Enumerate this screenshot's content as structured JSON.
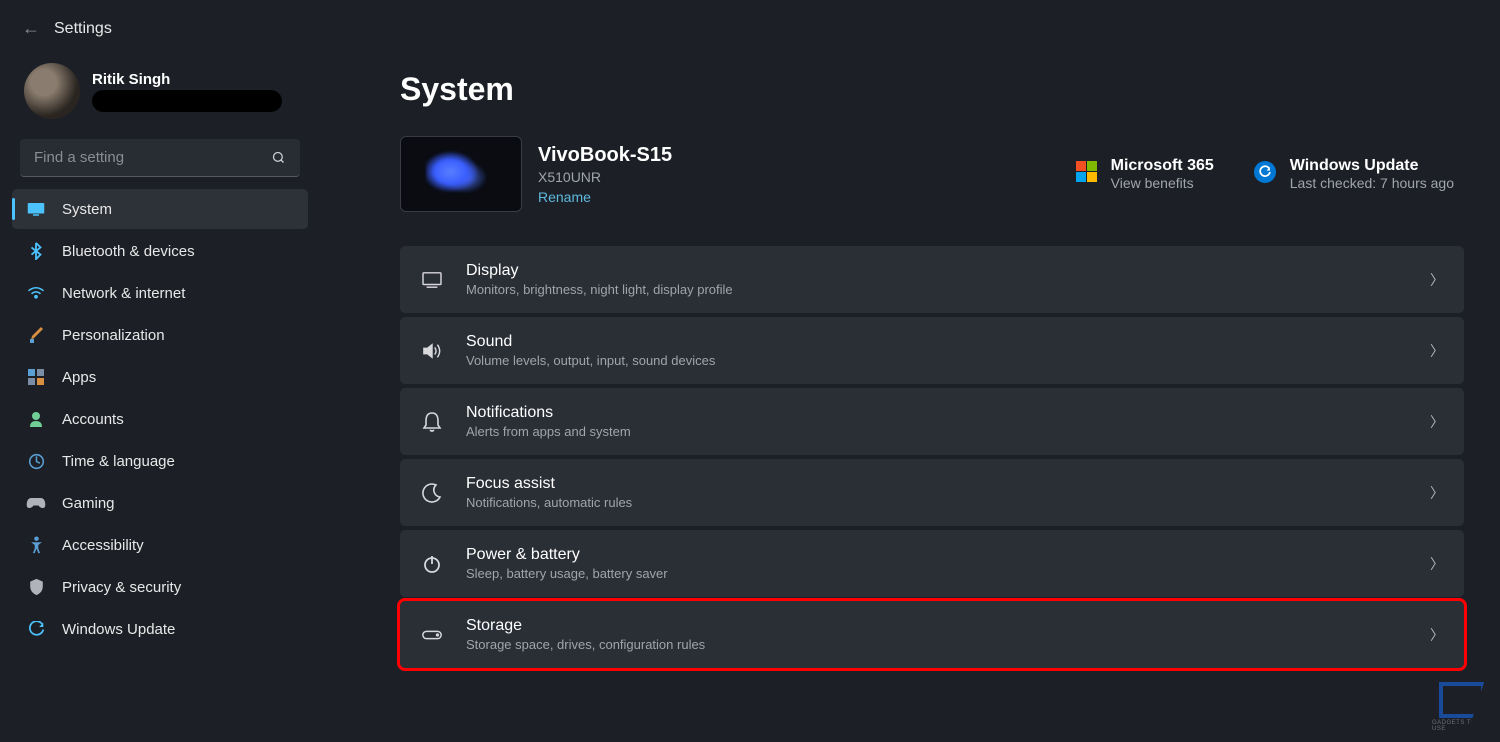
{
  "header": {
    "title": "Settings"
  },
  "user": {
    "name": "Ritik Singh"
  },
  "search": {
    "placeholder": "Find a setting"
  },
  "sidebar": {
    "items": [
      {
        "label": "System"
      },
      {
        "label": "Bluetooth & devices"
      },
      {
        "label": "Network & internet"
      },
      {
        "label": "Personalization"
      },
      {
        "label": "Apps"
      },
      {
        "label": "Accounts"
      },
      {
        "label": "Time & language"
      },
      {
        "label": "Gaming"
      },
      {
        "label": "Accessibility"
      },
      {
        "label": "Privacy & security"
      },
      {
        "label": "Windows Update"
      }
    ]
  },
  "page": {
    "title": "System"
  },
  "device": {
    "name": "VivoBook-S15",
    "model": "X510UNR",
    "rename": "Rename"
  },
  "cards": {
    "ms365_title": "Microsoft 365",
    "ms365_sub": "View benefits",
    "wu_title": "Windows Update",
    "wu_sub": "Last checked: 7 hours ago"
  },
  "settings": [
    {
      "title": "Display",
      "desc": "Monitors, brightness, night light, display profile"
    },
    {
      "title": "Sound",
      "desc": "Volume levels, output, input, sound devices"
    },
    {
      "title": "Notifications",
      "desc": "Alerts from apps and system"
    },
    {
      "title": "Focus assist",
      "desc": "Notifications, automatic rules"
    },
    {
      "title": "Power & battery",
      "desc": "Sleep, battery usage, battery saver"
    },
    {
      "title": "Storage",
      "desc": "Storage space, drives, configuration rules"
    }
  ],
  "watermark": "GADGETS TO USE"
}
